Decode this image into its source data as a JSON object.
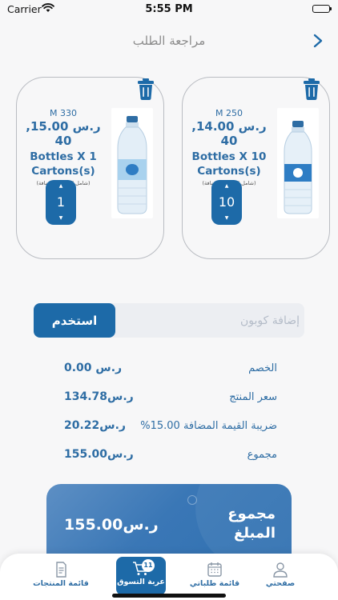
{
  "status_bar": {
    "carrier": "Carrier",
    "time": "5:55 PM"
  },
  "header": {
    "title": "مراجعة الطلب"
  },
  "products": [
    {
      "size": "M 330",
      "price": "ر.س 15.00, 40",
      "name_line1": "Bottles X 1",
      "name_line2": "Cartons(s)",
      "tax_note": "(شامل الضريبة المضافة)",
      "quantity": "1"
    },
    {
      "size": "M 250",
      "price": "ر.س 14.00, 40",
      "name_line1": "Bottles X 10",
      "name_line2": "Cartons(s)",
      "tax_note": "(شامل الضريبة المضافة)",
      "quantity": "10"
    }
  ],
  "coupon": {
    "placeholder": "إضافة كوبون",
    "apply_label": "استخدم"
  },
  "totals": [
    {
      "label": "الخصم",
      "value": "ر.س 0.00"
    },
    {
      "label": "سعر المنتج",
      "value": "ر.س134.78"
    },
    {
      "label": "ضريبة القيمة المضافة 15.00%",
      "value": "ر.س20.22"
    },
    {
      "label": "مجموع",
      "value": "ر.س155.00"
    }
  ],
  "grand_total": {
    "label": "مجموع المبلغ",
    "value": "ر.س155.00"
  },
  "tabbar": {
    "items": [
      {
        "label": "قائمة المنتجات",
        "icon": "document-list-icon"
      },
      {
        "label": "عربة التسوق",
        "icon": "cart-icon",
        "badge": "11"
      },
      {
        "label": "قائمة طلباتي",
        "icon": "calendar-icon"
      },
      {
        "label": "صفحتي",
        "icon": "person-icon"
      }
    ]
  },
  "colors": {
    "primary": "#1d6aa8",
    "text_blue": "#2e6da4",
    "gradient_start": "#5d8fc4",
    "gradient_end": "#2f70b1"
  }
}
